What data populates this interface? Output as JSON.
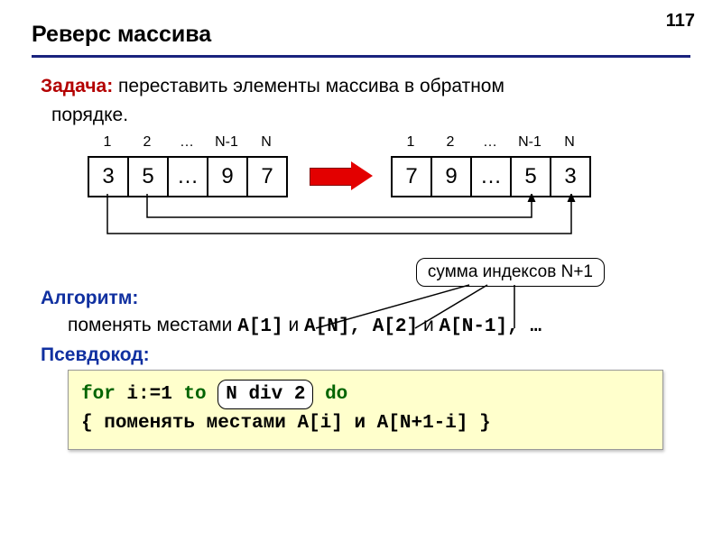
{
  "page_number": "117",
  "title": "Реверс массива",
  "task": {
    "label": "Задача:",
    "text1": " переставить элементы массива в обратном",
    "text2": "порядке."
  },
  "arrays": {
    "indices": [
      "1",
      "2",
      "…",
      "N-1",
      "N"
    ],
    "before": [
      "3",
      "5",
      "…",
      "9",
      "7"
    ],
    "after": [
      "7",
      "9",
      "…",
      "5",
      "3"
    ]
  },
  "algorithm": {
    "label": "Алгоритм:",
    "line_pre": "поменять местами ",
    "p1a": "A[1]",
    "p1mid": " и ",
    "p1b": "A[N]",
    "p2sep": ", ",
    "p2a": "A[2]",
    "p2mid": " и ",
    "p2b": "A[N-1]",
    "tail": ", …"
  },
  "callout": "сумма индексов N+1",
  "pseudocode": {
    "label": "Псевдокод:",
    "for_kw": "for ",
    "assign": "i:=1 ",
    "to_kw": "to ",
    "ndiv": "N div 2",
    "do_kw": " do",
    "body_open": " { ",
    "body_text": "поменять местами A[i] и A[N+1-i]",
    "body_close": " }"
  }
}
